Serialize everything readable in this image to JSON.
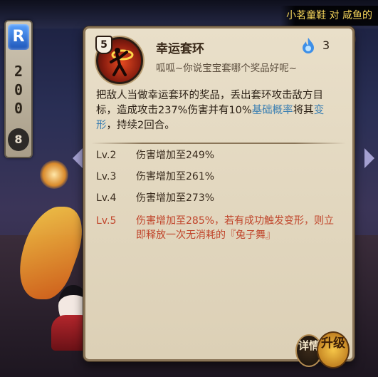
{
  "top_banner": {
    "text": "小茗童鞋 对 咸鱼的"
  },
  "left_bar": {
    "rarity": "R",
    "cost_digits": [
      "2",
      "0",
      "0"
    ],
    "star_count": "8"
  },
  "skill": {
    "level": "5",
    "name": "幸运套环",
    "flavor": "呱呱~你说宝宝套哪个奖品好呢~",
    "orb_cost": "3",
    "description_parts": [
      {
        "text": "把敌人当做幸运套环的奖品，丢出套环攻击敌方目标，造成攻击237%伤害并有10%",
        "keyword": false
      },
      {
        "text": "基础概率",
        "keyword": true
      },
      {
        "text": "将其",
        "keyword": false
      },
      {
        "text": "变形",
        "keyword": true
      },
      {
        "text": "，持续2回合。",
        "keyword": false
      }
    ],
    "levels": [
      {
        "lv": "Lv.2",
        "text": "伤害增加至249%"
      },
      {
        "lv": "Lv.3",
        "text": "伤害增加至261%"
      },
      {
        "lv": "Lv.4",
        "text": "伤害增加至273%"
      },
      {
        "lv": "Lv.5",
        "text": "伤害增加至285%，若有成功触发变形，则立即释放一次无消耗的『兔子舞』"
      }
    ]
  },
  "buttons": {
    "detail_label": "详情",
    "upgrade_label": "升级"
  },
  "colors": {
    "keyword": "#3b7fb2",
    "highlight_level": "#c0442a",
    "panel_bg": "#e9dfc9"
  },
  "icons": {
    "skill": "ring-toss-skill-icon",
    "orb": "blue-flame-orb-icon"
  }
}
